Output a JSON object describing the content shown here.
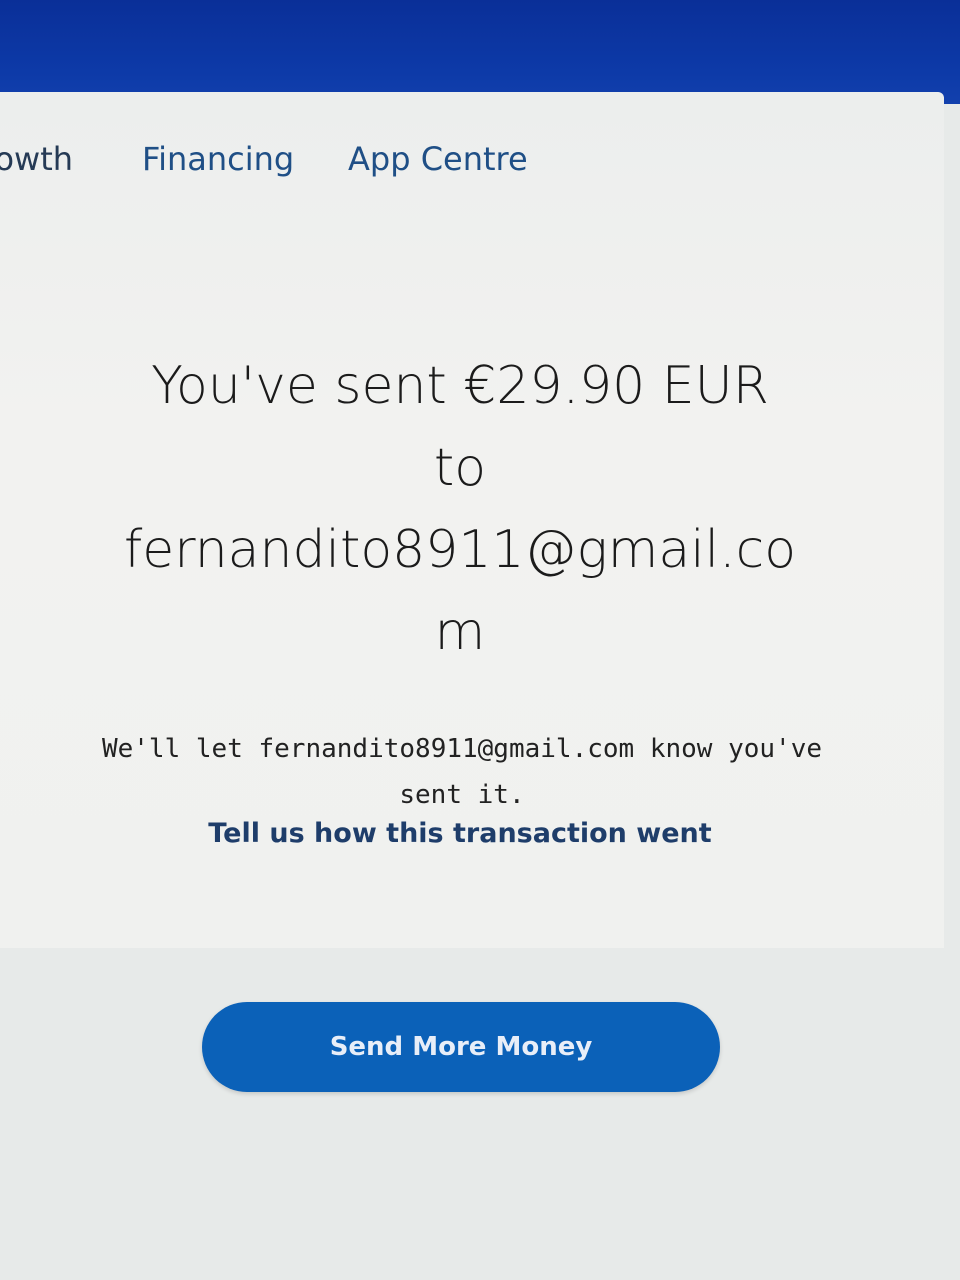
{
  "nav": {
    "items": [
      {
        "label": "rowth"
      },
      {
        "label": "Financing"
      },
      {
        "label": "App Centre"
      }
    ]
  },
  "confirmation": {
    "line1": "You've sent €29.90 EUR",
    "line2": "to",
    "line3": "fernandito8911@gmail.co",
    "line4": "m",
    "notice": "We'll let fernandito8911@gmail.com know you've sent it.",
    "feedback_link": "Tell us how this transaction went"
  },
  "actions": {
    "send_more_label": "Send More Money"
  },
  "colors": {
    "brand_blue": "#0b61b8",
    "header_blue": "#0a2f98",
    "link_blue": "#1e3d6a"
  }
}
